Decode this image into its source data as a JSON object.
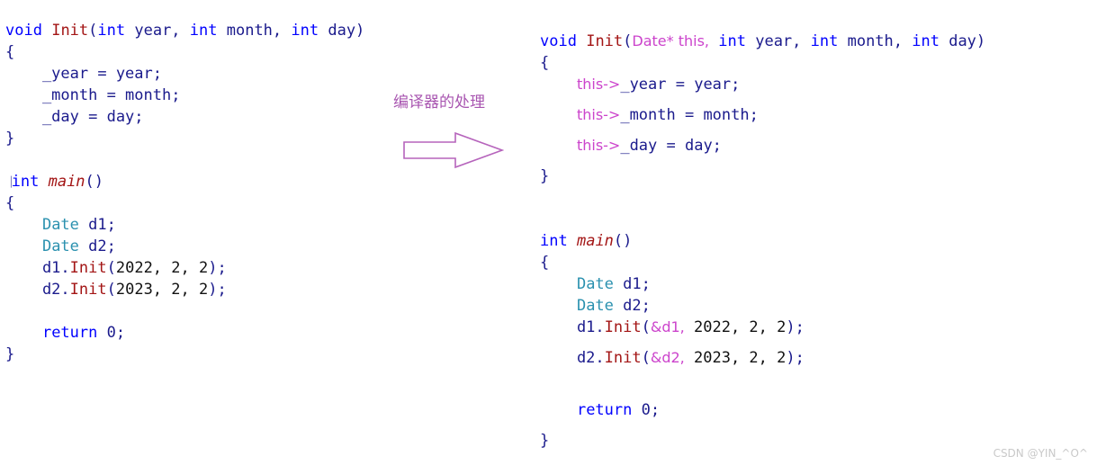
{
  "colors": {
    "background": "#ffffff",
    "keyword": "#0000ff",
    "function": "#a31515",
    "type": "#2b91af",
    "identifier": "#1a1a8c",
    "number": "#111111",
    "injected": "#cc44cc",
    "annotation": "#a855b0",
    "watermark": "#c9c9c9"
  },
  "left_code": {
    "title": "original-source-code",
    "lines": [
      {
        "tokens": [
          {
            "t": "void",
            "c": "kw"
          },
          {
            "t": " ",
            "c": "plain"
          },
          {
            "t": "Init",
            "c": "fn"
          },
          {
            "t": "(",
            "c": "punct"
          },
          {
            "t": "int",
            "c": "kw"
          },
          {
            "t": " year, ",
            "c": "plain"
          },
          {
            "t": "int",
            "c": "kw"
          },
          {
            "t": " month, ",
            "c": "plain"
          },
          {
            "t": "int",
            "c": "kw"
          },
          {
            "t": " day)",
            "c": "plain"
          }
        ]
      },
      {
        "tokens": [
          {
            "t": "{",
            "c": "plain"
          }
        ]
      },
      {
        "tokens": [
          {
            "t": "    _year = year;",
            "c": "plain"
          }
        ]
      },
      {
        "tokens": [
          {
            "t": "    _month = month;",
            "c": "plain"
          }
        ]
      },
      {
        "tokens": [
          {
            "t": "    _day = day;",
            "c": "plain"
          }
        ]
      },
      {
        "tokens": [
          {
            "t": "}",
            "c": "plain"
          }
        ]
      },
      {
        "tokens": [
          {
            "t": " ",
            "c": "plain"
          }
        ]
      },
      {
        "tokens": [
          {
            "t": "",
            "c": "artifact"
          },
          {
            "t": "int",
            "c": "kw"
          },
          {
            "t": " ",
            "c": "plain"
          },
          {
            "t": "main",
            "c": "fn-main"
          },
          {
            "t": "()",
            "c": "plain"
          }
        ]
      },
      {
        "tokens": [
          {
            "t": "{",
            "c": "plain"
          }
        ]
      },
      {
        "tokens": [
          {
            "t": "    ",
            "c": "plain"
          },
          {
            "t": "Date",
            "c": "type"
          },
          {
            "t": " d1;",
            "c": "plain"
          }
        ]
      },
      {
        "tokens": [
          {
            "t": "    ",
            "c": "plain"
          },
          {
            "t": "Date",
            "c": "type"
          },
          {
            "t": " d2;",
            "c": "plain"
          }
        ]
      },
      {
        "tokens": [
          {
            "t": "    d1.",
            "c": "plain"
          },
          {
            "t": "Init",
            "c": "fn"
          },
          {
            "t": "(",
            "c": "punct"
          },
          {
            "t": "2022, 2, 2",
            "c": "num"
          },
          {
            "t": ");",
            "c": "punct"
          }
        ]
      },
      {
        "tokens": [
          {
            "t": "    d2.",
            "c": "plain"
          },
          {
            "t": "Init",
            "c": "fn"
          },
          {
            "t": "(",
            "c": "punct"
          },
          {
            "t": "2023, 2, 2",
            "c": "num"
          },
          {
            "t": ");",
            "c": "punct"
          }
        ]
      },
      {
        "tokens": [
          {
            "t": " ",
            "c": "plain"
          }
        ]
      },
      {
        "tokens": [
          {
            "t": "    ",
            "c": "plain"
          },
          {
            "t": "return",
            "c": "kw"
          },
          {
            "t": " 0;",
            "c": "plain"
          }
        ]
      },
      {
        "tokens": [
          {
            "t": "}",
            "c": "plain"
          }
        ]
      }
    ]
  },
  "right_code": {
    "title": "compiler-transformed-code",
    "lines": [
      {
        "loose": false,
        "tokens": [
          {
            "t": "void",
            "c": "kw"
          },
          {
            "t": " ",
            "c": "plain"
          },
          {
            "t": "Init",
            "c": "fn"
          },
          {
            "t": "(",
            "c": "punct"
          },
          {
            "t": "Date* this,",
            "c": "inject"
          },
          {
            "t": " ",
            "c": "plain"
          },
          {
            "t": "int",
            "c": "kw"
          },
          {
            "t": " year, ",
            "c": "plain"
          },
          {
            "t": "int",
            "c": "kw"
          },
          {
            "t": " month, ",
            "c": "plain"
          },
          {
            "t": "int",
            "c": "kw"
          },
          {
            "t": " day)",
            "c": "plain"
          }
        ]
      },
      {
        "loose": false,
        "tokens": [
          {
            "t": "{",
            "c": "plain"
          }
        ]
      },
      {
        "loose": true,
        "tokens": [
          {
            "t": "    ",
            "c": "plain"
          },
          {
            "t": "this->",
            "c": "inject"
          },
          {
            "t": "_year = year;",
            "c": "plain"
          }
        ]
      },
      {
        "loose": true,
        "tokens": [
          {
            "t": "    ",
            "c": "plain"
          },
          {
            "t": "this->",
            "c": "inject"
          },
          {
            "t": "_month = month;",
            "c": "plain"
          }
        ]
      },
      {
        "loose": true,
        "tokens": [
          {
            "t": "    ",
            "c": "plain"
          },
          {
            "t": "this->",
            "c": "inject"
          },
          {
            "t": "_day = day;",
            "c": "plain"
          }
        ]
      },
      {
        "loose": false,
        "tokens": [
          {
            "t": "}",
            "c": "plain"
          }
        ]
      },
      {
        "loose": false,
        "tokens": [
          {
            "t": " ",
            "c": "plain"
          }
        ]
      },
      {
        "loose": false,
        "tokens": [
          {
            "t": " ",
            "c": "plain"
          }
        ]
      },
      {
        "loose": false,
        "tokens": [
          {
            "t": "int",
            "c": "kw"
          },
          {
            "t": " ",
            "c": "plain"
          },
          {
            "t": "main",
            "c": "fn-main"
          },
          {
            "t": "()",
            "c": "plain"
          }
        ]
      },
      {
        "loose": false,
        "tokens": [
          {
            "t": "{",
            "c": "plain"
          }
        ]
      },
      {
        "loose": false,
        "tokens": [
          {
            "t": "    ",
            "c": "plain"
          },
          {
            "t": "Date",
            "c": "type"
          },
          {
            "t": " d1;",
            "c": "plain"
          }
        ]
      },
      {
        "loose": false,
        "tokens": [
          {
            "t": "    ",
            "c": "plain"
          },
          {
            "t": "Date",
            "c": "type"
          },
          {
            "t": " d2;",
            "c": "plain"
          }
        ]
      },
      {
        "loose": true,
        "tokens": [
          {
            "t": "    d1.",
            "c": "plain"
          },
          {
            "t": "Init",
            "c": "fn"
          },
          {
            "t": "(",
            "c": "punct"
          },
          {
            "t": "&d1,",
            "c": "inject"
          },
          {
            "t": " ",
            "c": "plain"
          },
          {
            "t": "2022, 2, 2",
            "c": "num"
          },
          {
            "t": ");",
            "c": "punct"
          }
        ]
      },
      {
        "loose": true,
        "tokens": [
          {
            "t": "    d2.",
            "c": "plain"
          },
          {
            "t": "Init",
            "c": "fn"
          },
          {
            "t": "(",
            "c": "punct"
          },
          {
            "t": "&d2,",
            "c": "inject"
          },
          {
            "t": " ",
            "c": "plain"
          },
          {
            "t": "2023, 2, 2",
            "c": "num"
          },
          {
            "t": ");",
            "c": "punct"
          }
        ]
      },
      {
        "loose": false,
        "tokens": [
          {
            "t": " ",
            "c": "plain"
          }
        ]
      },
      {
        "loose": true,
        "tokens": [
          {
            "t": "    ",
            "c": "plain"
          },
          {
            "t": "return",
            "c": "kw"
          },
          {
            "t": " 0;",
            "c": "plain"
          }
        ]
      },
      {
        "loose": false,
        "tokens": [
          {
            "t": "}",
            "c": "plain"
          }
        ]
      }
    ]
  },
  "annotation": {
    "label": "编译器的处理",
    "arrow": "right-block-arrow"
  },
  "watermark": {
    "text": "CSDN @YIN_^O^"
  }
}
